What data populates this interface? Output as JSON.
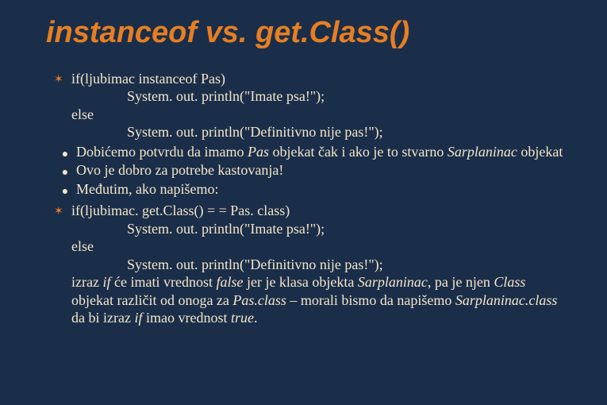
{
  "title": "instanceof vs. get.Class()",
  "code1": {
    "l1": "if(ljubimac instanceof Pas)",
    "l2": "System. out. println(\"Imate psa!\");",
    "l3": "else",
    "l4": "System. out. println(\"Definitivno nije pas!\");"
  },
  "b1": {
    "pre": "Dobićemo potvrdu da imamo ",
    "it1": "Pas",
    "mid": " objekat čak i ako je to stvarno ",
    "it2": "Sarplaninac",
    "post": " objekat"
  },
  "b2": "Ovo je dobro za potrebe kastovanja!",
  "b3": "Međutim, ako napišemo:",
  "code2": {
    "l1": "if(ljubimac. get.Class() = = Pas. class)",
    "l2": "System. out. println(\"Imate psa!\");",
    "l3": "else",
    "l4": "System. out. println(\"Definitivno nije pas!\");"
  },
  "p": {
    "s1": "izraz ",
    "i1": "if",
    "s2": " će imati vrednost ",
    "i2": "false",
    "s3": " jer je klasa objekta ",
    "i3": "Sarplaninac",
    "s4": ", pa je njen ",
    "i4": "Class",
    "s5": " objekat različit od onoga za ",
    "i5": "Pas.class",
    "s6": " – morali bismo da napišemo ",
    "i6": "Sarplaninac.class",
    "s7": " da bi izraz ",
    "i7": "if",
    "s8": " imao vrednost ",
    "i8": "true",
    "s9": "."
  }
}
